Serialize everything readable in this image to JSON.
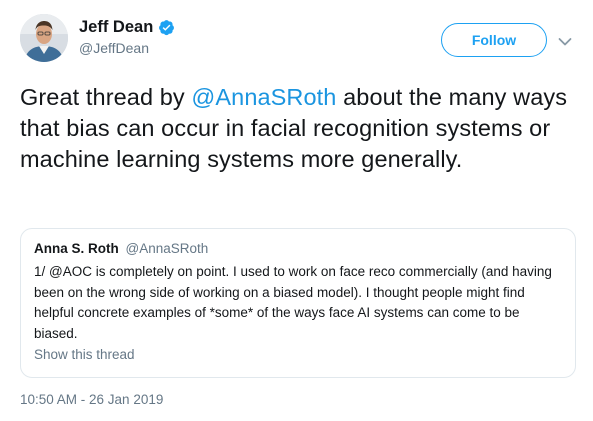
{
  "author": {
    "display_name": "Jeff Dean",
    "handle": "@JeffDean",
    "verified_icon": "verified-badge-icon",
    "avatar_icon": "avatar"
  },
  "actions": {
    "follow_label": "Follow",
    "more_icon": "chevron-down-icon"
  },
  "tweet": {
    "text_before": "Great thread by ",
    "mention": "@AnnaSRoth",
    "text_after": " about the many ways that bias can occur in facial recognition systems or machine learning systems more generally."
  },
  "quoted_tweet": {
    "display_name": "Anna S. Roth",
    "handle": "@AnnaSRoth",
    "text": "1/ @AOC is completely on point. I used to work on face reco commercially (and having been on the wrong side of working on a biased model). I thought people might find helpful concrete examples of *some* of the ways face AI systems can come to be biased.",
    "show_thread_label": "Show this thread"
  },
  "timestamp": "10:50 AM - 26 Jan 2019",
  "colors": {
    "accent": "#1da1f2",
    "mention": "#1b95e0",
    "muted": "#657786",
    "border": "#e1e8ed",
    "text": "#14171a"
  }
}
